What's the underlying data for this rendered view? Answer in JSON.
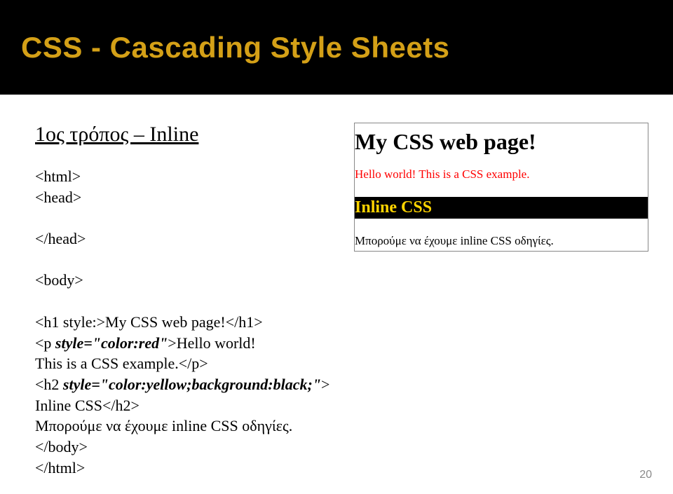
{
  "title": "CSS - Cascading Style Sheets",
  "method_heading": "1ος τρόπος – Inline",
  "code": {
    "l1": "<html>",
    "l2": "<head>",
    "l3": "</head>",
    "l4": "<body>",
    "l5": "<h1 style:>My CSS web page!</h1>",
    "l6a": "<p ",
    "l6b": "style=\"color:red\"",
    "l6c": ">Hello world!",
    "l7": "This is a CSS example.</p>",
    "l8a": "<h2 ",
    "l8b": "style=\"color:yellow;background:black;\"",
    "l8c": ">",
    "l9": "Inline CSS</h2>",
    "l10": "Μπορούμε να έχουμε inline CSS οδηγίες.",
    "l11": "</body>",
    "l12": "</html>"
  },
  "preview": {
    "h1": "My CSS web page!",
    "p": "Hello world! This is a CSS example.",
    "h2": "Inline CSS",
    "body_text": "Μπορούμε να έχουμε inline CSS οδηγίες."
  },
  "page_number": "20"
}
